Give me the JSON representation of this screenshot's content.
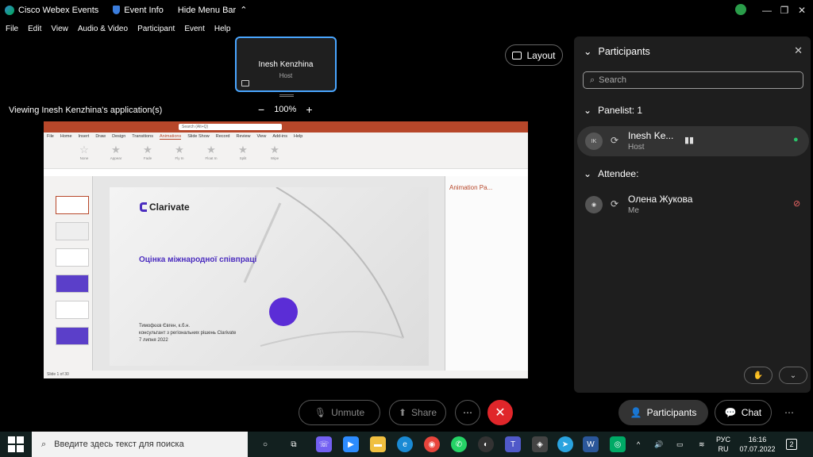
{
  "titlebar": {
    "app_name": "Cisco Webex Events",
    "event_info": "Event Info",
    "hide_menu": "Hide Menu Bar"
  },
  "menu": [
    "File",
    "Edit",
    "View",
    "Audio & Video",
    "Participant",
    "Event",
    "Help"
  ],
  "host_tile": {
    "name": "Inesh Kenzhina",
    "role": "Host"
  },
  "layout_label": "Layout",
  "viewing_label": "Viewing Inesh Kenzhina's application(s)",
  "zoom": {
    "minus": "−",
    "value": "100%",
    "plus": "+"
  },
  "shared": {
    "search_placeholder": "Search (Alt+Q)",
    "menu": [
      "File",
      "Home",
      "Insert",
      "Draw",
      "Design",
      "Transitions",
      "Animations",
      "Slide Show",
      "Record",
      "Review",
      "View",
      "Add-ins",
      "Help"
    ],
    "animations": [
      "None",
      "Appear",
      "Fade",
      "Fly In",
      "Float In",
      "Split",
      "Wipe"
    ],
    "slide_logo": "Clarivate",
    "slide_title": "Оцінка міжнародної співпраці",
    "slide_info_1": "Тимофєєв Євген, к.б.н.",
    "slide_info_2": "консультант з регіональних рішень Clarivate",
    "slide_info_3": "7 липня 2022",
    "anim_pane_title": "Animation Pa...",
    "status": "Slide 1 of 30"
  },
  "panel": {
    "title": "Participants",
    "search_placeholder": "Search",
    "panelist_header": "Panelist: 1",
    "panelist": {
      "name": "Inesh Ke...",
      "role": "Host",
      "initials": "IK"
    },
    "attendee_header": "Attendee:",
    "attendee": {
      "name": "Олена Жукова",
      "role": "Me"
    }
  },
  "controls": {
    "unmute": "Unmute",
    "share": "Share",
    "participants": "Participants",
    "chat": "Chat"
  },
  "taskbar": {
    "search_placeholder": "Введите здесь текст для поиска",
    "lang_1": "РУС",
    "lang_2": "RU",
    "time": "16:16",
    "date": "07.07.2022",
    "notif_count": "2"
  }
}
